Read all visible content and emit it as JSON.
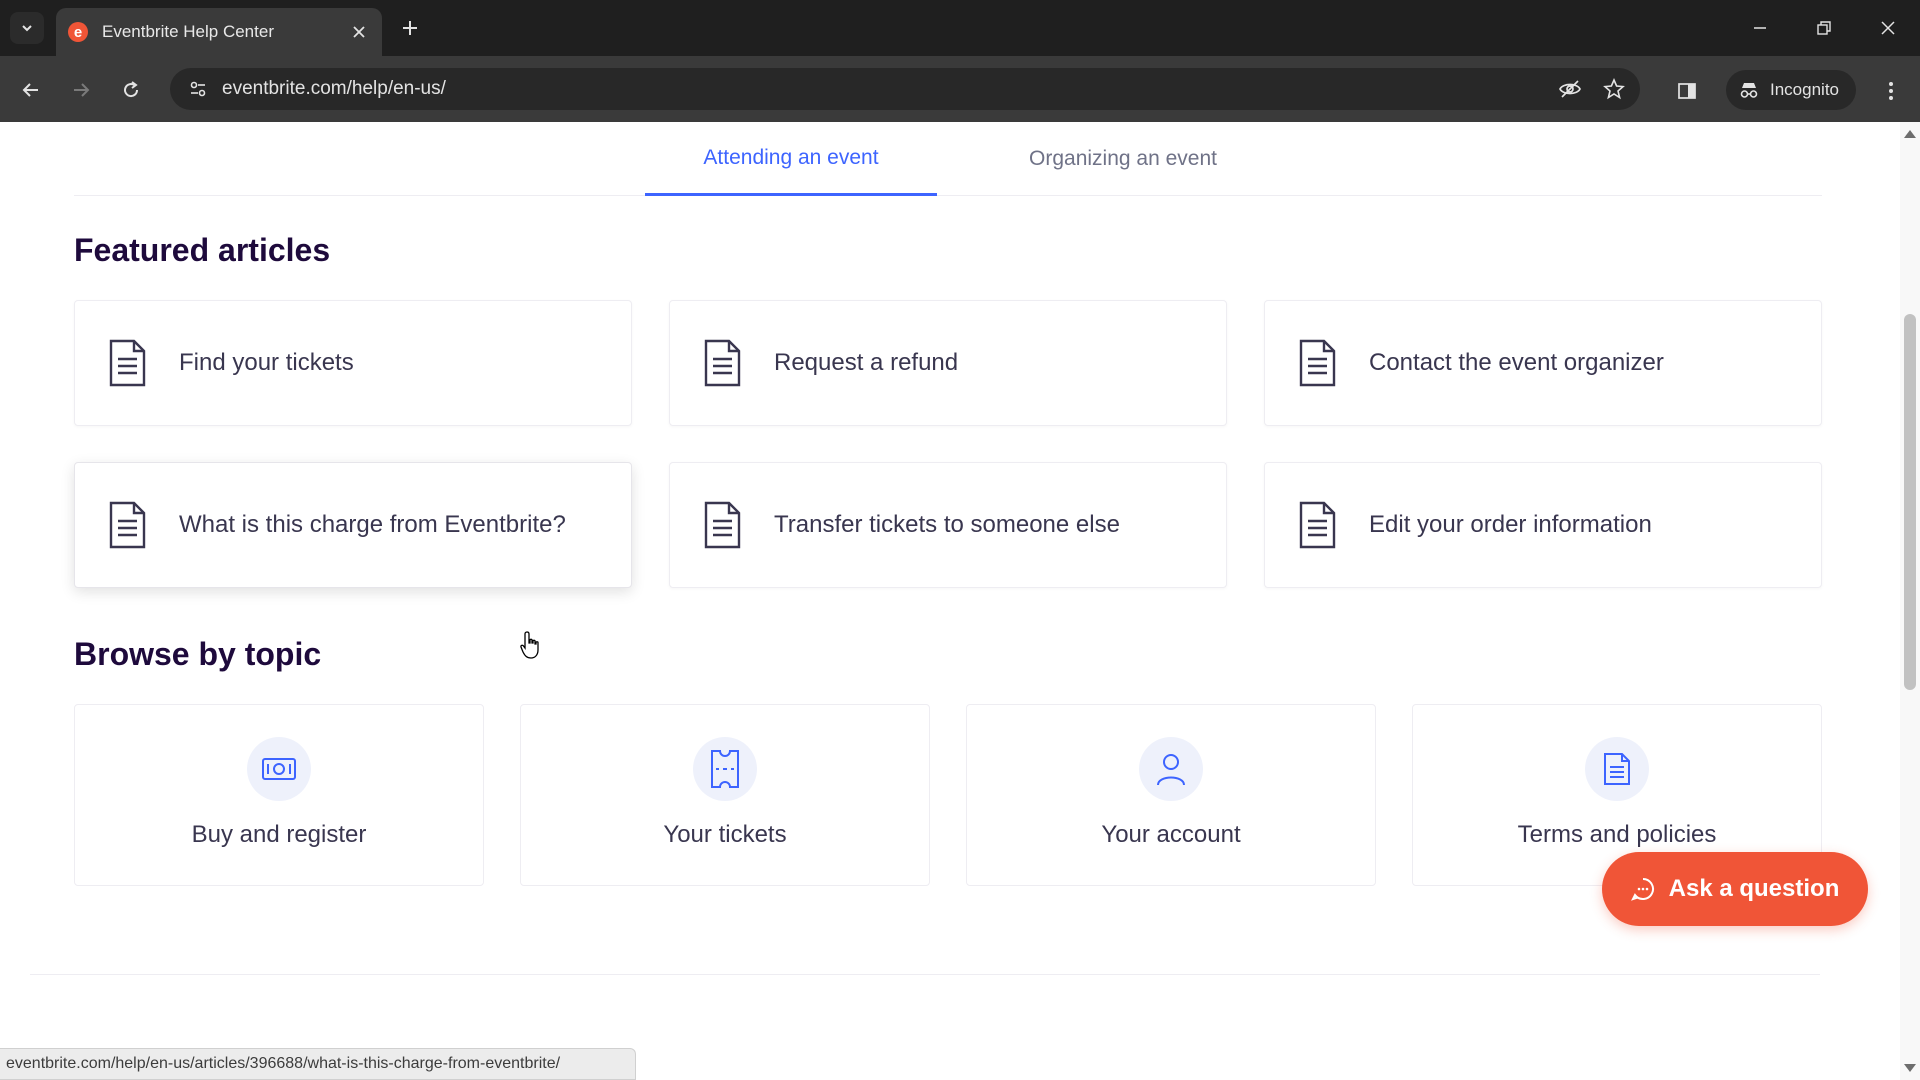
{
  "browser": {
    "tab_title": "Eventbrite Help Center",
    "favicon_letter": "e",
    "url": "eventbrite.com/help/en-us/",
    "incognito_label": "Incognito",
    "status_url": "eventbrite.com/help/en-us/articles/396688/what-is-this-charge-from-eventbrite/"
  },
  "tabs": [
    {
      "label": "Attending an event",
      "active": true
    },
    {
      "label": "Organizing an event",
      "active": false
    }
  ],
  "featured": {
    "title": "Featured articles",
    "articles": [
      {
        "label": "Find your tickets"
      },
      {
        "label": "Request a refund"
      },
      {
        "label": "Contact the event organizer"
      },
      {
        "label": "What is this charge from Eventbrite?"
      },
      {
        "label": "Transfer tickets to someone else"
      },
      {
        "label": "Edit your order information"
      }
    ]
  },
  "browse": {
    "title": "Browse by topic",
    "topics": [
      {
        "label": "Buy and register",
        "icon": "ticket-cash-icon"
      },
      {
        "label": "Your tickets",
        "icon": "ticket-icon"
      },
      {
        "label": "Your account",
        "icon": "user-icon"
      },
      {
        "label": "Terms and policies",
        "icon": "document-icon"
      }
    ]
  },
  "ask_button": "Ask a question",
  "colors": {
    "brand": "#f05537",
    "accent": "#3d64ff",
    "heading": "#1e0a3c",
    "text": "#39364f"
  }
}
